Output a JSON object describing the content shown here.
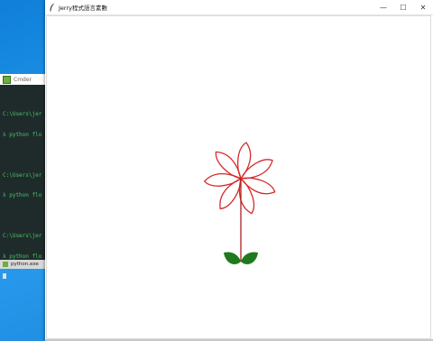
{
  "cmder": {
    "title": "Cmder",
    "lines": [
      "C:\\Users\\jer",
      "λ python flo",
      "",
      "C:\\Users\\jer",
      "λ python flo",
      "",
      "C:\\Users\\jer",
      "λ python flo"
    ],
    "tab_label": "python.exe"
  },
  "turtle": {
    "title": "Jerry程式語言素數",
    "controls": {
      "minimize": "—",
      "maximize": "☐",
      "close": "✕"
    }
  },
  "drawing": {
    "petal_color": "#d42a2a",
    "stem_color": "#b01e1e",
    "leaf_color": "#1f7a1f",
    "petal_count": 7
  }
}
